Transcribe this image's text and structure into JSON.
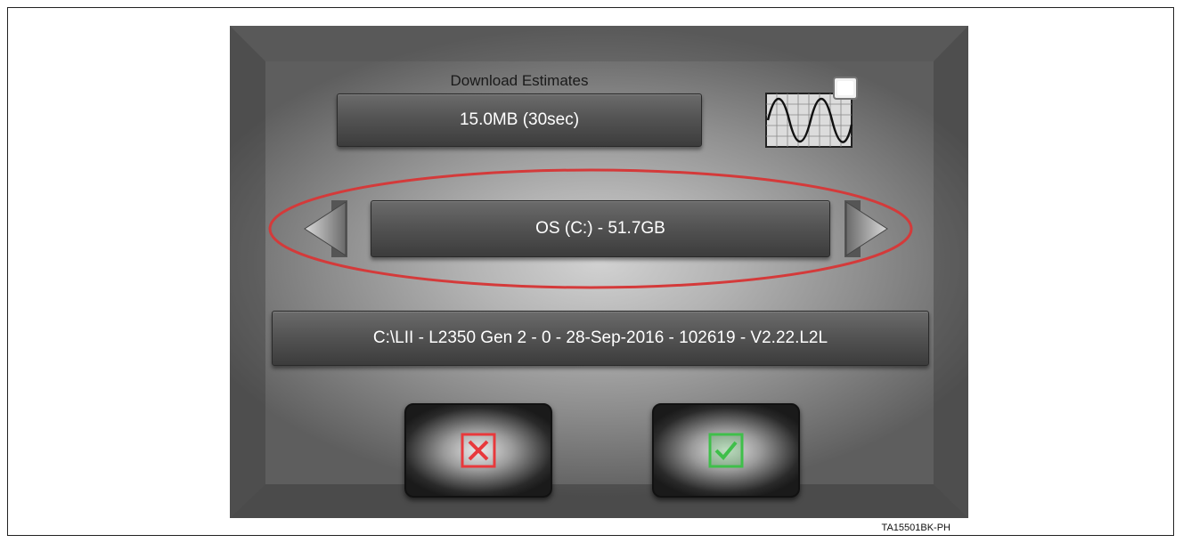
{
  "download_estimates": {
    "title": "Download Estimates",
    "value": "15.0MB (30sec)"
  },
  "drive_selector": {
    "value": "OS (C:) - 51.7GB",
    "prev_icon": "left-arrow-icon",
    "next_icon": "right-arrow-icon"
  },
  "file_path": {
    "value": "C:\\LII - L2350 Gen 2 - 0 - 28-Sep-2016 - 102619 - V2.22.L2L"
  },
  "actions": {
    "cancel_icon": "x-icon",
    "confirm_icon": "checkmark-icon"
  },
  "colors": {
    "highlight": "#d43a3a",
    "cancel": "#e8393c",
    "confirm": "#3fbf4a"
  },
  "caption": "TA15501BK-PH"
}
